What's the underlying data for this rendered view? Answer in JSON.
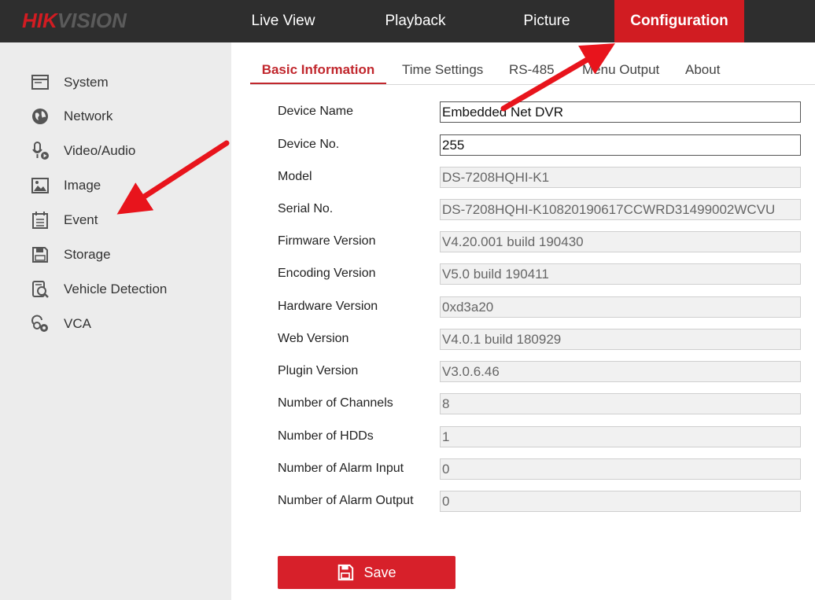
{
  "brand": {
    "logo_part1": "HIK",
    "logo_part2": "VISION"
  },
  "topnav": {
    "live_view": "Live View",
    "playback": "Playback",
    "picture": "Picture",
    "configuration": "Configuration"
  },
  "sidebar": {
    "items": [
      {
        "label": "System",
        "icon": "system-icon"
      },
      {
        "label": "Network",
        "icon": "network-icon"
      },
      {
        "label": "Video/Audio",
        "icon": "video-audio-icon"
      },
      {
        "label": "Image",
        "icon": "image-icon"
      },
      {
        "label": "Event",
        "icon": "event-icon"
      },
      {
        "label": "Storage",
        "icon": "storage-icon"
      },
      {
        "label": "Vehicle Detection",
        "icon": "vehicle-detection-icon"
      },
      {
        "label": "VCA",
        "icon": "vca-icon"
      }
    ]
  },
  "tabs": {
    "basic": "Basic Information",
    "time": "Time Settings",
    "rs485": "RS-485",
    "menu_output": "Menu Output",
    "about": "About"
  },
  "form": {
    "device_name": {
      "label": "Device Name",
      "value": "Embedded Net DVR"
    },
    "device_no": {
      "label": "Device No.",
      "value": "255"
    },
    "model": {
      "label": "Model",
      "value": "DS-7208HQHI-K1"
    },
    "serial_no": {
      "label": "Serial No.",
      "value": "DS-7208HQHI-K10820190617CCWRD31499002WCVU"
    },
    "firmware": {
      "label": "Firmware Version",
      "value": "V4.20.001 build 190430"
    },
    "encoding": {
      "label": "Encoding Version",
      "value": "V5.0 build 190411"
    },
    "hardware": {
      "label": "Hardware Version",
      "value": "0xd3a20"
    },
    "web": {
      "label": "Web Version",
      "value": "V4.0.1 build 180929"
    },
    "plugin": {
      "label": "Plugin Version",
      "value": "V3.0.6.46"
    },
    "channels": {
      "label": "Number of Channels",
      "value": "8"
    },
    "hdds": {
      "label": "Number of HDDs",
      "value": "1"
    },
    "alarm_in": {
      "label": "Number of Alarm Input",
      "value": "0"
    },
    "alarm_out": {
      "label": "Number of Alarm Output",
      "value": "0"
    }
  },
  "save": {
    "label": "Save",
    "icon": "save-icon"
  },
  "colors": {
    "accent": "#d11c22",
    "topbar": "#2e2e2e",
    "sidebar": "#ececec"
  }
}
